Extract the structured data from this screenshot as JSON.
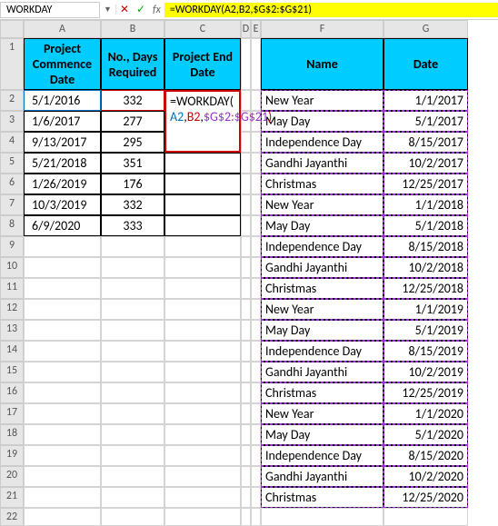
{
  "formula_bar": {
    "name_box": "WORKDAY",
    "formula": "=WORKDAY(A2,B2,$G$2:$G$21)"
  },
  "columns": [
    "A",
    "B",
    "C",
    "D",
    "E",
    "F",
    "G"
  ],
  "rows": [
    "1",
    "2",
    "3",
    "4",
    "5",
    "6",
    "7",
    "8",
    "9",
    "10",
    "11",
    "12",
    "13",
    "14",
    "15",
    "16",
    "17",
    "18",
    "19",
    "20",
    "21",
    "22"
  ],
  "headers": {
    "A": "Project Commence Date",
    "B": "No., Days Required",
    "C": "Project End Date",
    "F": "Name",
    "G": "Date"
  },
  "left_table": [
    {
      "date": "5/1/2016",
      "days": "332"
    },
    {
      "date": "1/6/2017",
      "days": "277"
    },
    {
      "date": "9/13/2017",
      "days": "295"
    },
    {
      "date": "5/21/2018",
      "days": "351"
    },
    {
      "date": "1/26/2019",
      "days": "176"
    },
    {
      "date": "10/3/2019",
      "days": "332"
    },
    {
      "date": "6/9/2020",
      "days": "333"
    }
  ],
  "formula_parts": {
    "fn": "=WORKDAY(",
    "a": "A2",
    "sep1": ",",
    "b": "B2",
    "sep2": ",",
    "g": "$G$2:$G$21",
    "close": ")"
  },
  "right_table": [
    {
      "name": "New Year",
      "date": "1/1/2017"
    },
    {
      "name": "May Day",
      "date": "5/1/2017"
    },
    {
      "name": "Independence Day",
      "date": "8/15/2017"
    },
    {
      "name": "Gandhi Jayanthi",
      "date": "10/2/2017"
    },
    {
      "name": "Christmas",
      "date": "12/25/2017"
    },
    {
      "name": "New Year",
      "date": "1/1/2018"
    },
    {
      "name": "May Day",
      "date": "5/1/2018"
    },
    {
      "name": "Independence Day",
      "date": "8/15/2018"
    },
    {
      "name": "Gandhi Jayanthi",
      "date": "10/2/2018"
    },
    {
      "name": "Christmas",
      "date": "12/25/2018"
    },
    {
      "name": "New Year",
      "date": "1/1/2019"
    },
    {
      "name": "May Day",
      "date": "5/1/2019"
    },
    {
      "name": "Independence Day",
      "date": "8/15/2019"
    },
    {
      "name": "Gandhi Jayanthi",
      "date": "10/2/2019"
    },
    {
      "name": "Christmas",
      "date": "12/25/2019"
    },
    {
      "name": "New Year",
      "date": "1/1/2020"
    },
    {
      "name": "May Day",
      "date": "5/1/2020"
    },
    {
      "name": "Independence Day",
      "date": "8/15/2020"
    },
    {
      "name": "Gandhi Jayanthi",
      "date": "10/2/2020"
    },
    {
      "name": "Christmas",
      "date": "12/25/2020"
    }
  ]
}
